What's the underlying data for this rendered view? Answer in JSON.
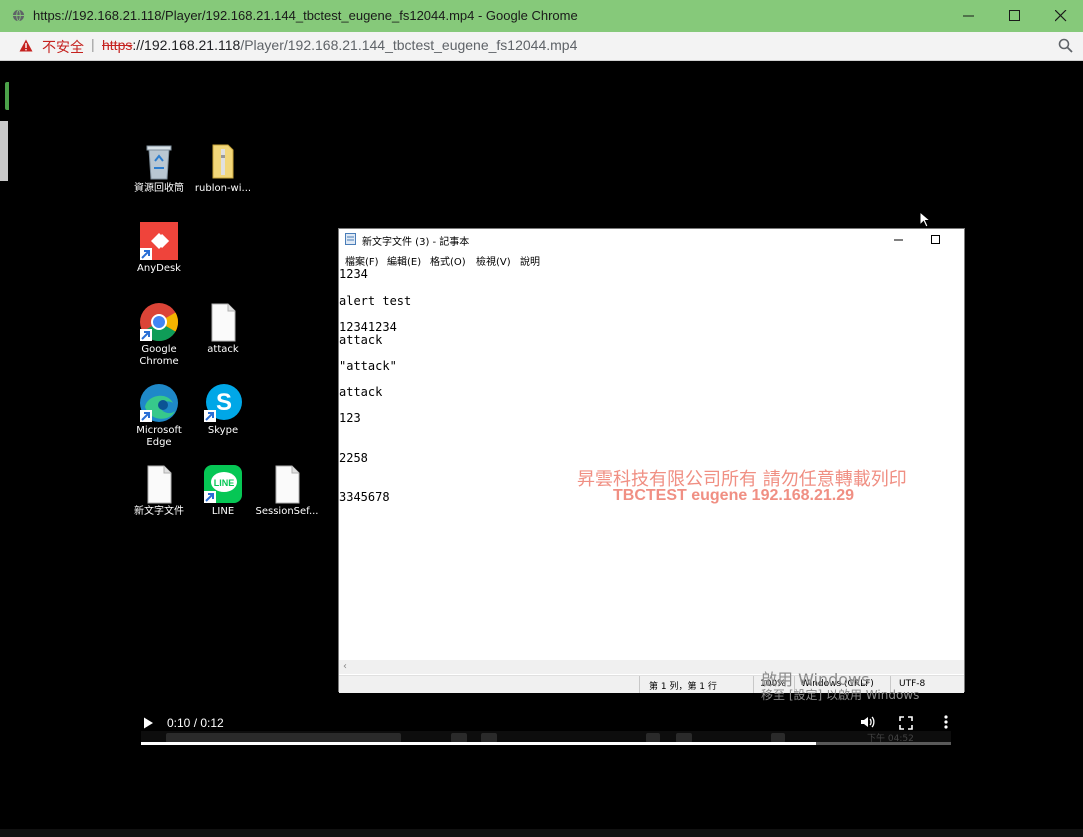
{
  "browser": {
    "window_title": "https://192.168.21.118/Player/192.168.21.144_tbctest_eugene_fs12044.mp4 - Google Chrome",
    "security_label": "不安全",
    "separator": "|",
    "url_scheme": "https",
    "url_host": "://192.168.21.118",
    "url_path": "/Player/192.168.21.144_tbctest_eugene_fs12044.mp4",
    "titlebar_color": "#86c97a"
  },
  "desktop": {
    "icons": [
      {
        "label": "資源回收筒",
        "icon": "recycle-bin-icon"
      },
      {
        "label": "rublon-wi...",
        "icon": "folder-icon"
      },
      {
        "label": "AnyDesk",
        "icon": "anydesk-icon"
      },
      {
        "label": "Google\nChrome",
        "icon": "chrome-icon"
      },
      {
        "label": "attack",
        "icon": "text-file-icon"
      },
      {
        "label": "Microsoft\nEdge",
        "icon": "edge-icon"
      },
      {
        "label": "Skype",
        "icon": "skype-icon"
      },
      {
        "label": "新文字文件",
        "icon": "text-file-icon"
      },
      {
        "label": "LINE",
        "icon": "line-icon"
      },
      {
        "label": "SessionSef...",
        "icon": "text-file-icon"
      }
    ]
  },
  "notepad": {
    "title": "新文字文件 (3) - 記事本",
    "menu": [
      "檔案(F)",
      "編輯(E)",
      "格式(O)",
      "檢視(V)",
      "說明"
    ],
    "lines": [
      "1234",
      "alert test",
      "12341234",
      "attack",
      "\"attack\"",
      "attack",
      "123",
      "2258",
      "3345678"
    ],
    "status": {
      "position": "第 1 列，第 1 行",
      "zoom": "100%",
      "line_ending": "Windows (CRLF)",
      "encoding": "UTF-8"
    }
  },
  "watermark": {
    "line1": "昇雲科技有限公司所有 請勿任意轉載列印",
    "line2": "TBCTEST eugene 192.168.21.29",
    "color": "#f08f83"
  },
  "activation": {
    "line1": "啟用 Windows",
    "line2": "移至 [設定] 以啟用 Windows"
  },
  "video": {
    "time": "0:10 / 0:12",
    "progress": 0.8333,
    "clock": "下午 04:52"
  }
}
